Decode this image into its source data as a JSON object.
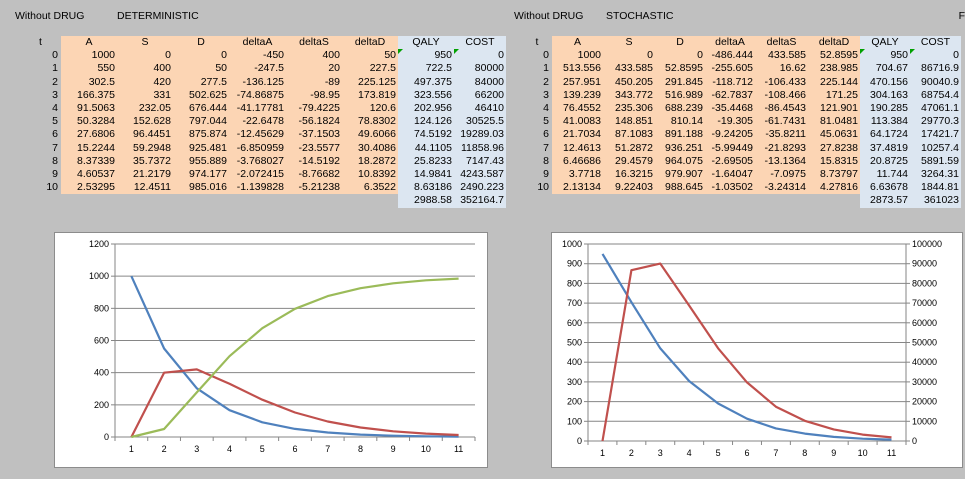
{
  "left": {
    "title1": "Without DRUG",
    "title2": "DETERMINISTIC",
    "headers": [
      "t",
      "A",
      "S",
      "D",
      "deltaA",
      "deltaS",
      "deltaD",
      "QALY",
      "COST"
    ],
    "rows": [
      [
        "0",
        "1000",
        "0",
        "0",
        "-450",
        "400",
        "50",
        "950",
        "0"
      ],
      [
        "1",
        "550",
        "400",
        "50",
        "-247.5",
        "20",
        "227.5",
        "722.5",
        "80000"
      ],
      [
        "2",
        "302.5",
        "420",
        "277.5",
        "-136.125",
        "-89",
        "225.125",
        "497.375",
        "84000"
      ],
      [
        "3",
        "166.375",
        "331",
        "502.625",
        "-74.86875",
        "-98.95",
        "173.819",
        "323.556",
        "66200"
      ],
      [
        "4",
        "91.5063",
        "232.05",
        "676.444",
        "-41.17781",
        "-79.4225",
        "120.6",
        "202.956",
        "46410"
      ],
      [
        "5",
        "50.3284",
        "152.628",
        "797.044",
        "-22.6478",
        "-56.1824",
        "78.8302",
        "124.126",
        "30525.5"
      ],
      [
        "6",
        "27.6806",
        "96.4451",
        "875.874",
        "-12.45629",
        "-37.1503",
        "49.6066",
        "74.5192",
        "19289.03"
      ],
      [
        "7",
        "15.2244",
        "59.2948",
        "925.481",
        "-6.850959",
        "-23.5577",
        "30.4086",
        "44.1105",
        "11858.96"
      ],
      [
        "8",
        "8.37339",
        "35.7372",
        "955.889",
        "-3.768027",
        "-14.5192",
        "18.2872",
        "25.8233",
        "7147.43"
      ],
      [
        "9",
        "4.60537",
        "21.2179",
        "974.177",
        "-2.072415",
        "-8.76682",
        "10.8392",
        "14.9841",
        "4243.587"
      ],
      [
        "10",
        "2.53295",
        "12.4511",
        "985.016",
        "-1.139828",
        "-5.21238",
        "6.3522",
        "8.63186",
        "2490.223"
      ]
    ],
    "totals": [
      "2988.58",
      "352164.7"
    ]
  },
  "right": {
    "title1": "Without DRUG",
    "title2": "STOCHASTIC",
    "edge_char": "F",
    "headers": [
      "t",
      "A",
      "S",
      "D",
      "deltaA",
      "deltaS",
      "deltaD",
      "QALY",
      "COST"
    ],
    "rows": [
      [
        "0",
        "1000",
        "0",
        "0",
        "-486.444",
        "433.585",
        "52.8595",
        "950",
        "0"
      ],
      [
        "1",
        "513.556",
        "433.585",
        "52.8595",
        "-255.605",
        "16.62",
        "238.985",
        "704.67",
        "86716.9"
      ],
      [
        "2",
        "257.951",
        "450.205",
        "291.845",
        "-118.712",
        "-106.433",
        "225.144",
        "470.156",
        "90040.9"
      ],
      [
        "3",
        "139.239",
        "343.772",
        "516.989",
        "-62.7837",
        "-108.466",
        "171.25",
        "304.163",
        "68754.4"
      ],
      [
        "4",
        "76.4552",
        "235.306",
        "688.239",
        "-35.4468",
        "-86.4543",
        "121.901",
        "190.285",
        "47061.1"
      ],
      [
        "5",
        "41.0083",
        "148.851",
        "810.14",
        "-19.305",
        "-61.7431",
        "81.0481",
        "113.384",
        "29770.3"
      ],
      [
        "6",
        "21.7034",
        "87.1083",
        "891.188",
        "-9.24205",
        "-35.8211",
        "45.0631",
        "64.1724",
        "17421.7"
      ],
      [
        "7",
        "12.4613",
        "51.2872",
        "936.251",
        "-5.99449",
        "-21.8293",
        "27.8238",
        "37.4819",
        "10257.4"
      ],
      [
        "8",
        "6.46686",
        "29.4579",
        "964.075",
        "-2.69505",
        "-13.1364",
        "15.8315",
        "20.8725",
        "5891.59"
      ],
      [
        "9",
        "3.7718",
        "16.3215",
        "979.907",
        "-1.64047",
        "-7.0975",
        "8.73797",
        "11.744",
        "3264.31"
      ],
      [
        "10",
        "2.13134",
        "9.22403",
        "988.645",
        "-1.03502",
        "-3.24314",
        "4.27816",
        "6.63678",
        "1844.81"
      ]
    ],
    "totals": [
      "2873.57",
      "361023"
    ]
  },
  "chart_data": [
    {
      "type": "line",
      "categories": [
        "1",
        "2",
        "3",
        "4",
        "5",
        "6",
        "7",
        "8",
        "9",
        "10",
        "11"
      ],
      "ylim": [
        0,
        1200
      ],
      "yticks": [
        "0",
        "200",
        "400",
        "600",
        "800",
        "1000",
        "1200"
      ],
      "series": [
        {
          "color": "#4f81bd",
          "values": [
            1000,
            550,
            302.5,
            166.375,
            91.5063,
            50.3284,
            27.6806,
            15.2244,
            8.37339,
            4.60537,
            2.53295
          ]
        },
        {
          "color": "#c0504d",
          "values": [
            0,
            400,
            420,
            331,
            232.05,
            152.628,
            96.4451,
            59.2948,
            35.7372,
            21.2179,
            12.4511
          ]
        },
        {
          "color": "#9bbb59",
          "values": [
            0,
            50,
            277.5,
            502.625,
            676.444,
            797.044,
            875.874,
            925.481,
            955.889,
            974.177,
            985.016
          ]
        }
      ],
      "grid": true
    },
    {
      "type": "line",
      "categories": [
        "1",
        "2",
        "3",
        "4",
        "5",
        "6",
        "7",
        "8",
        "9",
        "10",
        "11"
      ],
      "ylim": [
        0,
        1000
      ],
      "y2lim": [
        0,
        100000
      ],
      "yticks": [
        "0",
        "100",
        "200",
        "300",
        "400",
        "500",
        "600",
        "700",
        "800",
        "900",
        "1000"
      ],
      "y2ticks": [
        "0",
        "10000",
        "20000",
        "30000",
        "40000",
        "50000",
        "60000",
        "70000",
        "80000",
        "90000",
        "100000"
      ],
      "series": [
        {
          "color": "#4f81bd",
          "axis": "left",
          "values": [
            950,
            704.67,
            470.156,
            304.163,
            190.285,
            113.384,
            64.1724,
            37.4819,
            20.8725,
            11.744,
            6.63678
          ]
        },
        {
          "color": "#c0504d",
          "axis": "right",
          "values": [
            0,
            86716.9,
            90040.9,
            68754.4,
            47061.1,
            29770.3,
            17421.7,
            10257.4,
            5891.59,
            3264.31,
            1844.81
          ]
        }
      ],
      "grid": true
    }
  ]
}
